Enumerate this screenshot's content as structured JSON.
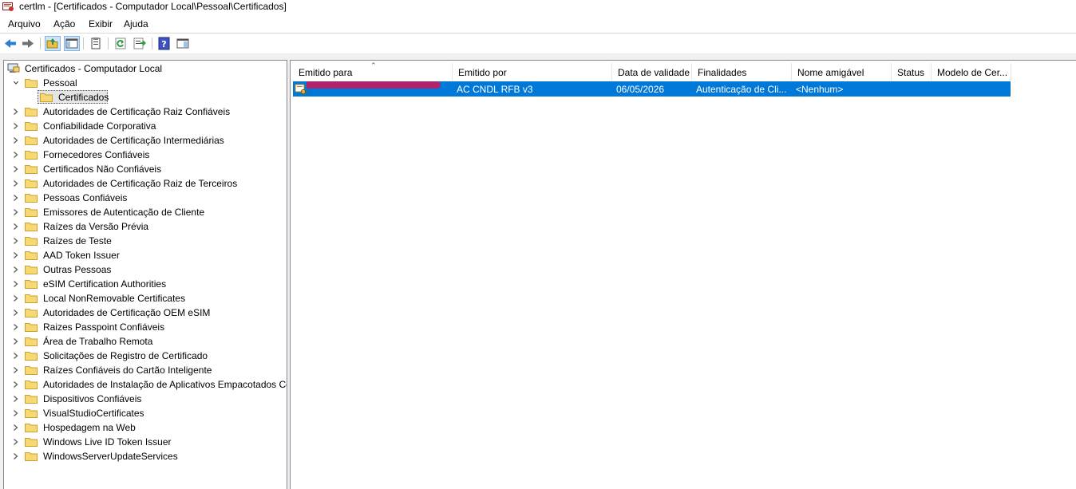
{
  "window": {
    "title": "certlm - [Certificados - Computador Local\\Pessoal\\Certificados]"
  },
  "menu": [
    "Arquivo",
    "Ação",
    "Exibir",
    "Ajuda"
  ],
  "tree": {
    "root": "Certificados - Computador Local",
    "personal": "Pessoal",
    "personal_child": "Certificados",
    "items": [
      "Autoridades de Certificação Raiz Confiáveis",
      "Confiabilidade Corporativa",
      "Autoridades de Certificação Intermediárias",
      "Fornecedores Confiáveis",
      "Certificados Não Confiáveis",
      "Autoridades de Certificação Raiz de Terceiros",
      "Pessoas Confiáveis",
      "Emissores de Autenticação de Cliente",
      "Raízes da Versão Prévia",
      "Raízes de Teste",
      "AAD Token Issuer",
      "Outras Pessoas",
      "eSIM Certification Authorities",
      "Local NonRemovable Certificates",
      "Autoridades de Certificação OEM eSIM",
      "Raizes Passpoint Confiáveis",
      "Área de Trabalho Remota",
      "Solicitações de Registro de Certificado",
      "Raízes Confiáveis do Cartão Inteligente",
      "Autoridades de Instalação de Aplicativos Empacotados Com",
      "Dispositivos Confiáveis",
      "VisualStudioCertificates",
      "Hospedagem na Web",
      "Windows Live ID Token Issuer",
      "WindowsServerUpdateServices"
    ]
  },
  "list": {
    "columns": [
      "Emitido para",
      "Emitido por",
      "Data de validade",
      "Finalidades",
      "Nome amigável",
      "Status",
      "Modelo de Cer..."
    ],
    "rows": [
      {
        "issued_to": "",
        "issued_by": "AC CNDL RFB v3",
        "expiration": "06/05/2026",
        "purposes": "Autenticação de Cli...",
        "friendly_name": "<Nenhum>",
        "status": "",
        "template": ""
      }
    ]
  },
  "colors": {
    "selection": "#0078d7",
    "redaction": "#b0246c"
  },
  "icons": [
    "back-arrow-icon",
    "forward-arrow-icon",
    "up-folder-icon",
    "show-hide-tree-icon",
    "properties-icon",
    "refresh-icon",
    "export-list-icon",
    "help-icon",
    "view-icon"
  ]
}
